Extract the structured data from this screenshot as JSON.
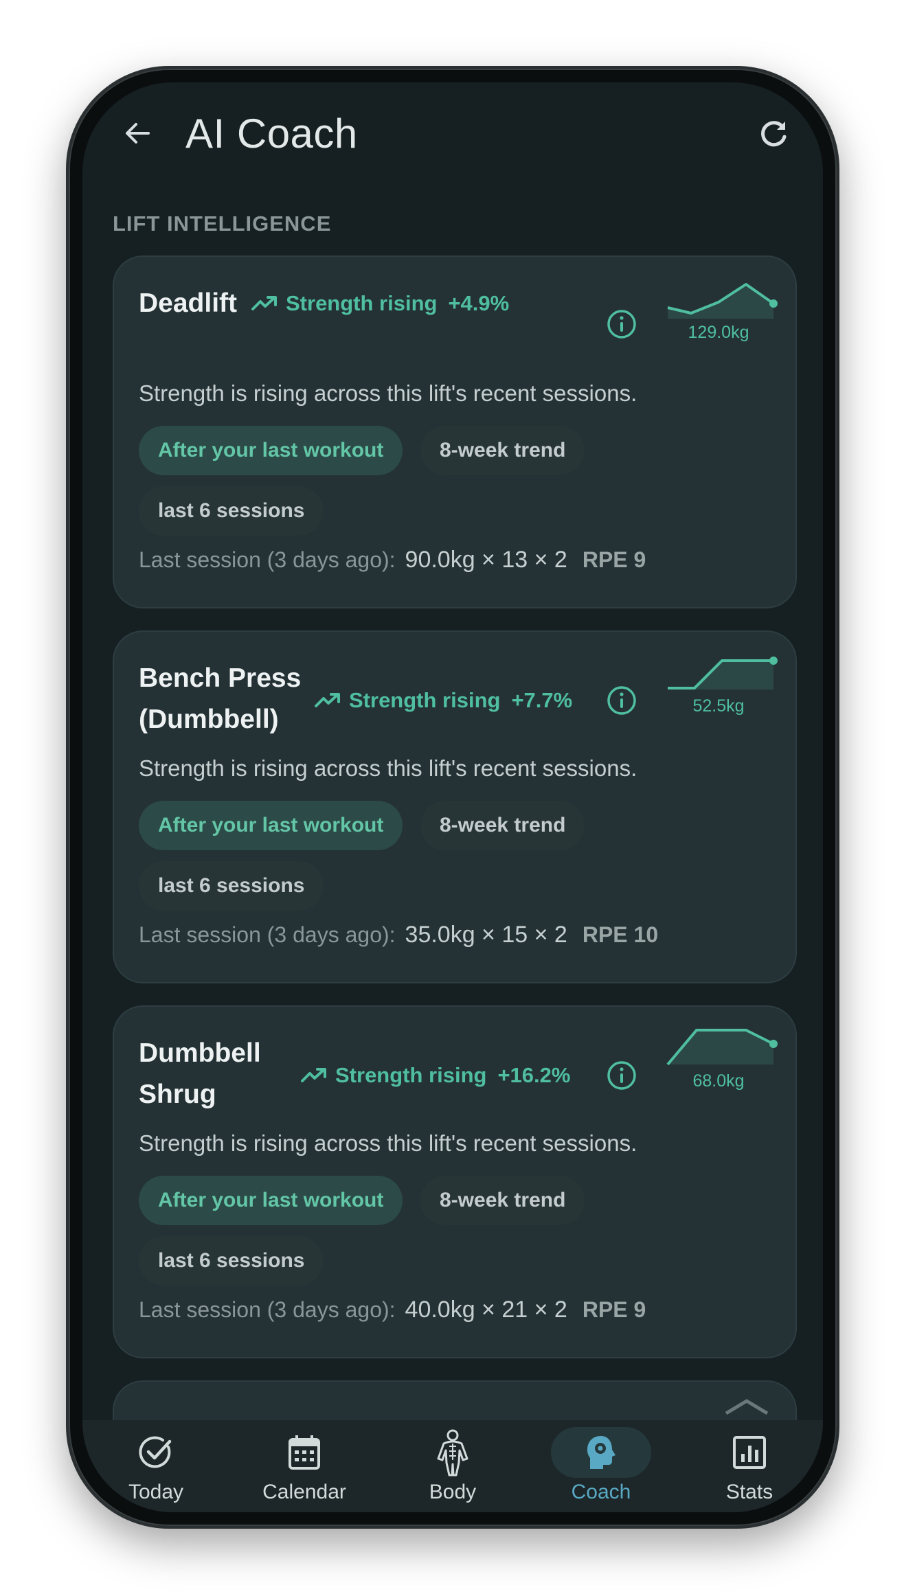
{
  "header": {
    "title": "AI Coach"
  },
  "section_label": "LIFT INTELLIGENCE",
  "cards": [
    {
      "name_line1": "Deadlift",
      "name_line2": "",
      "trend_label": "Strength rising",
      "trend_value": "+4.9%",
      "spark_label": "129.0kg",
      "summary": "Strength is rising across this lift's recent sessions.",
      "chips": [
        "After your last workout",
        "8-week trend",
        "last 6 sessions"
      ],
      "last_session_label": "Last session (3 days ago):",
      "last_session_sets": "90.0kg × 13 × 2",
      "last_session_rpe": "RPE 9"
    },
    {
      "name_line1": "Bench Press",
      "name_line2": "(Dumbbell)",
      "trend_label": "Strength rising",
      "trend_value": "+7.7%",
      "spark_label": "52.5kg",
      "summary": "Strength is rising across this lift's recent sessions.",
      "chips": [
        "After your last workout",
        "8-week trend",
        "last 6 sessions"
      ],
      "last_session_label": "Last session (3 days ago):",
      "last_session_sets": "35.0kg × 15 × 2",
      "last_session_rpe": "RPE 10"
    },
    {
      "name_line1": "Dumbbell",
      "name_line2": "Shrug",
      "trend_label": "Strength rising",
      "trend_value": "+16.2%",
      "spark_label": "68.0kg",
      "summary": "Strength is rising across this lift's recent sessions.",
      "chips": [
        "After your last workout",
        "8-week trend",
        "last 6 sessions"
      ],
      "last_session_label": "Last session (3 days ago):",
      "last_session_sets": "40.0kg × 21 × 2",
      "last_session_rpe": "RPE 9"
    }
  ],
  "nav": {
    "items": [
      {
        "label": "Today",
        "icon": "check-circle-icon"
      },
      {
        "label": "Calendar",
        "icon": "calendar-icon"
      },
      {
        "label": "Body",
        "icon": "body-icon"
      },
      {
        "label": "Coach",
        "icon": "coach-brain-icon",
        "active": true
      },
      {
        "label": "Stats",
        "icon": "stats-icon"
      }
    ]
  },
  "colors": {
    "accent": "#4fbf9f",
    "nav_active": "#59a9c4",
    "background": "#162022",
    "card": "#243236"
  }
}
